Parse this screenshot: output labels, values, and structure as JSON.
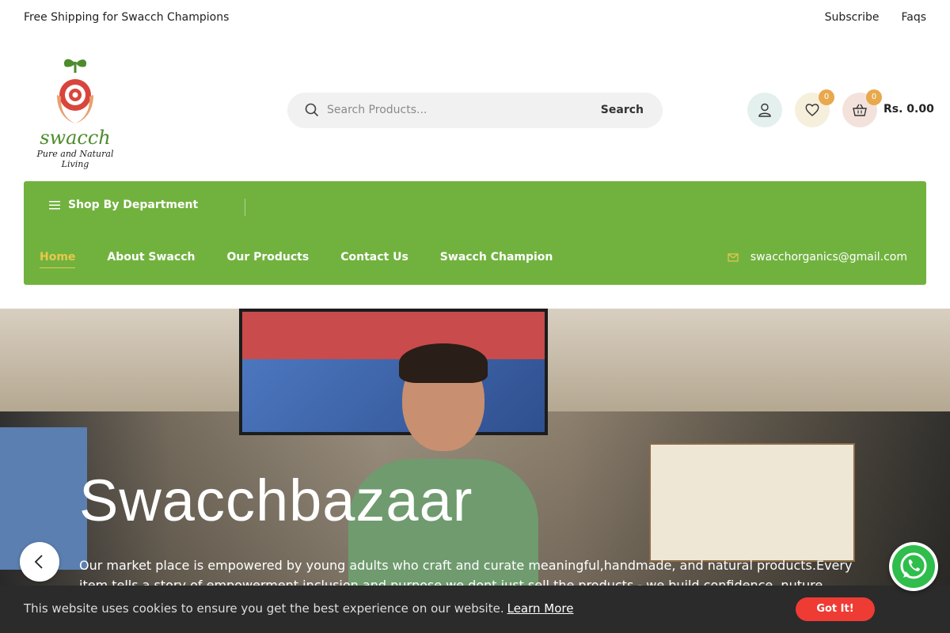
{
  "topbar": {
    "promo": "Free Shipping for Swacch Champions",
    "subscribe": "Subscribe",
    "faqs": "Faqs"
  },
  "logo": {
    "brand": "swacch",
    "tagline": "Pure and Natural Living"
  },
  "search": {
    "placeholder": "Search Products...",
    "button": "Search"
  },
  "header_actions": {
    "wishlist_count": "0",
    "cart_count": "0",
    "cart_total": "Rs. 0.00"
  },
  "nav": {
    "department_label": "Shop By Department",
    "items": [
      {
        "label": "Home",
        "active": true
      },
      {
        "label": "About Swacch"
      },
      {
        "label": "Our Products"
      },
      {
        "label": "Contact Us"
      },
      {
        "label": "Swacch Champion"
      }
    ],
    "email": "swacchorganics@gmail.com"
  },
  "hero": {
    "title": "Swacchbazaar",
    "description": "Our market place is empowered by young adults who craft and curate meaningful,handmade, and natural products.Every item tells a story of empowerment inclusion and purpose.we dont just sell the products - we build confidence, nuture talent, and"
  },
  "cookie": {
    "message": "This website uses cookies to ensure you get the best experience on our website.",
    "learn_more": "Learn More",
    "accept": "Got It!"
  },
  "colors": {
    "nav_green": "#71b23f",
    "active_yellow": "#e9c84a",
    "badge_orange": "#e8a84c",
    "cookie_button_red": "#ee3b34"
  },
  "icons": [
    "search-icon",
    "user-icon",
    "heart-icon",
    "basket-icon",
    "menu-icon",
    "email-icon",
    "chevron-left-icon",
    "whatsapp-icon"
  ]
}
